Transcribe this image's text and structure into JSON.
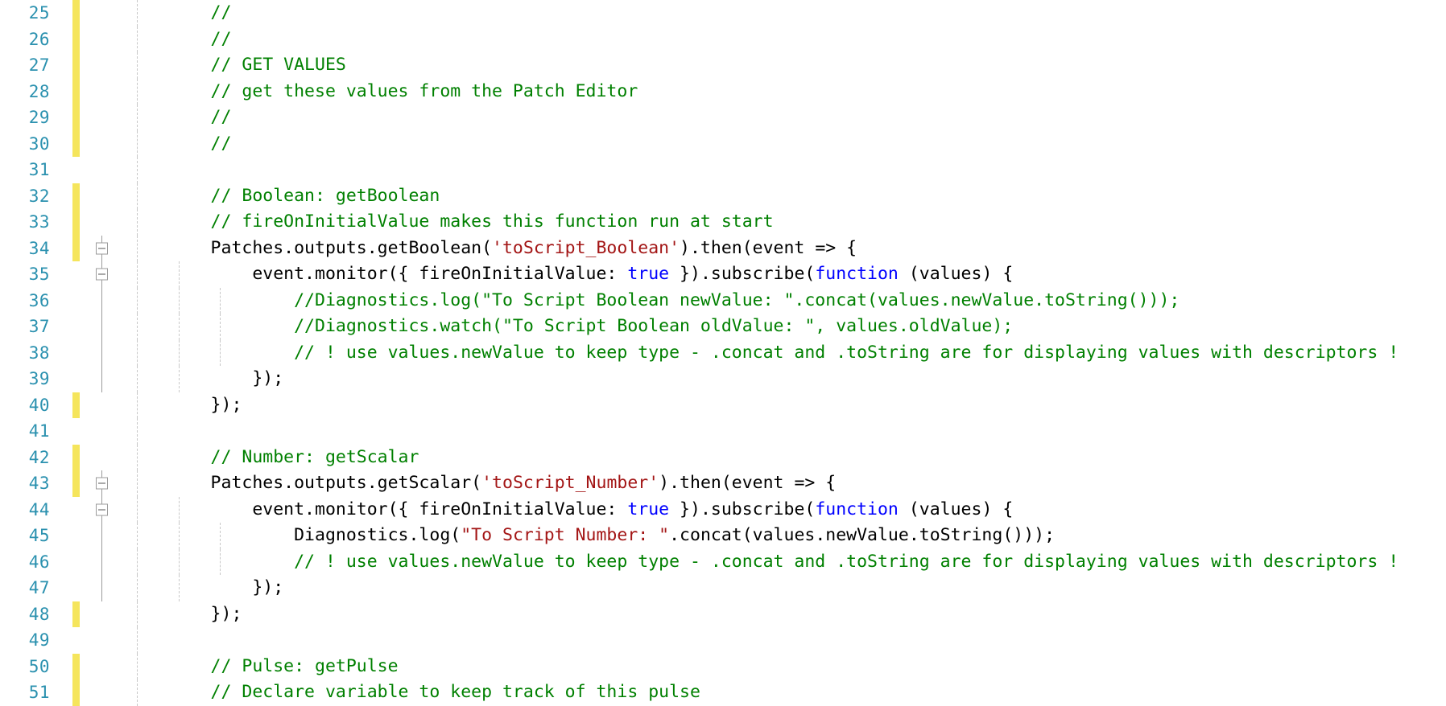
{
  "editor": {
    "name": "code-editor",
    "language": "javascript",
    "first_visible_line": 25,
    "last_visible_line": 51,
    "colors": {
      "background": "#ffffff",
      "line_number": "#2b91af",
      "comment": "#008000",
      "string": "#a31515",
      "keyword": "#0000ff",
      "plain_text": "#000000",
      "change_bar_modified": "#f5e55c",
      "indent_guide": "#c8c8c8",
      "fold_marker_border": "#9b9b9b"
    },
    "lines": [
      {
        "number": "25",
        "changed": true,
        "fold": false,
        "indent_guides": 1,
        "tokens": [
          {
            "text": "        // ",
            "cls": "t-comment"
          }
        ]
      },
      {
        "number": "26",
        "changed": true,
        "fold": false,
        "indent_guides": 1,
        "tokens": [
          {
            "text": "        //",
            "cls": "t-comment"
          }
        ]
      },
      {
        "number": "27",
        "changed": true,
        "fold": false,
        "indent_guides": 1,
        "tokens": [
          {
            "text": "        // GET VALUES",
            "cls": "t-comment"
          }
        ]
      },
      {
        "number": "28",
        "changed": true,
        "fold": false,
        "indent_guides": 1,
        "tokens": [
          {
            "text": "        // get these values from the Patch Editor",
            "cls": "t-comment"
          }
        ]
      },
      {
        "number": "29",
        "changed": true,
        "fold": false,
        "indent_guides": 1,
        "tokens": [
          {
            "text": "        //",
            "cls": "t-comment"
          }
        ]
      },
      {
        "number": "30",
        "changed": true,
        "fold": false,
        "indent_guides": 1,
        "tokens": [
          {
            "text": "        //",
            "cls": "t-comment"
          }
        ]
      },
      {
        "number": "31",
        "changed": false,
        "fold": false,
        "indent_guides": 1,
        "tokens": []
      },
      {
        "number": "32",
        "changed": true,
        "fold": false,
        "indent_guides": 1,
        "tokens": [
          {
            "text": "        // Boolean: getBoolean",
            "cls": "t-comment"
          }
        ]
      },
      {
        "number": "33",
        "changed": true,
        "fold": false,
        "indent_guides": 1,
        "tokens": [
          {
            "text": "        // fireOnInitialValue makes this function run at start",
            "cls": "t-comment"
          }
        ]
      },
      {
        "number": "34",
        "changed": true,
        "fold": true,
        "indent_guides": 1,
        "tokens": [
          {
            "text": "        Patches.outputs.getBoolean(",
            "cls": "t-plain"
          },
          {
            "text": "'toScript_Boolean'",
            "cls": "t-string"
          },
          {
            "text": ").then(event => {",
            "cls": "t-plain"
          }
        ]
      },
      {
        "number": "35",
        "changed": false,
        "fold": true,
        "indent_guides": 2,
        "tokens": [
          {
            "text": "            event.monitor({ fireOnInitialValue: ",
            "cls": "t-plain"
          },
          {
            "text": "true",
            "cls": "t-keyword"
          },
          {
            "text": " }).subscribe(",
            "cls": "t-plain"
          },
          {
            "text": "function",
            "cls": "t-keyword"
          },
          {
            "text": " (values) {",
            "cls": "t-plain"
          }
        ]
      },
      {
        "number": "36",
        "changed": false,
        "fold": false,
        "indent_guides": 3,
        "tokens": [
          {
            "text": "                //Diagnostics.log(\"To Script Boolean newValue: \".concat(values.newValue.toString()));",
            "cls": "t-comment"
          }
        ]
      },
      {
        "number": "37",
        "changed": false,
        "fold": false,
        "indent_guides": 3,
        "tokens": [
          {
            "text": "                //Diagnostics.watch(\"To Script Boolean oldValue: \", values.oldValue);",
            "cls": "t-comment"
          }
        ]
      },
      {
        "number": "38",
        "changed": false,
        "fold": false,
        "indent_guides": 3,
        "tokens": [
          {
            "text": "                // ! use values.newValue to keep type - .concat and .toString are for displaying values with descriptors !",
            "cls": "t-comment"
          }
        ]
      },
      {
        "number": "39",
        "changed": false,
        "fold": false,
        "indent_guides": 2,
        "tokens": [
          {
            "text": "            });",
            "cls": "t-plain"
          }
        ]
      },
      {
        "number": "40",
        "changed": true,
        "fold": false,
        "indent_guides": 1,
        "tokens": [
          {
            "text": "        });",
            "cls": "t-plain"
          }
        ]
      },
      {
        "number": "41",
        "changed": false,
        "fold": false,
        "indent_guides": 1,
        "tokens": []
      },
      {
        "number": "42",
        "changed": true,
        "fold": false,
        "indent_guides": 1,
        "tokens": [
          {
            "text": "        // Number: getScalar",
            "cls": "t-comment"
          }
        ]
      },
      {
        "number": "43",
        "changed": true,
        "fold": true,
        "indent_guides": 1,
        "tokens": [
          {
            "text": "        Patches.outputs.getScalar(",
            "cls": "t-plain"
          },
          {
            "text": "'toScript_Number'",
            "cls": "t-string"
          },
          {
            "text": ").then(event => {",
            "cls": "t-plain"
          }
        ]
      },
      {
        "number": "44",
        "changed": false,
        "fold": true,
        "indent_guides": 2,
        "tokens": [
          {
            "text": "            event.monitor({ fireOnInitialValue: ",
            "cls": "t-plain"
          },
          {
            "text": "true",
            "cls": "t-keyword"
          },
          {
            "text": " }).subscribe(",
            "cls": "t-plain"
          },
          {
            "text": "function",
            "cls": "t-keyword"
          },
          {
            "text": " (values) {",
            "cls": "t-plain"
          }
        ]
      },
      {
        "number": "45",
        "changed": false,
        "fold": false,
        "indent_guides": 3,
        "tokens": [
          {
            "text": "                Diagnostics.log(",
            "cls": "t-plain"
          },
          {
            "text": "\"To Script Number: \"",
            "cls": "t-string"
          },
          {
            "text": ".concat(values.newValue.toString()));",
            "cls": "t-plain"
          }
        ]
      },
      {
        "number": "46",
        "changed": false,
        "fold": false,
        "indent_guides": 3,
        "tokens": [
          {
            "text": "                // ! use values.newValue to keep type - .concat and .toString are for displaying values with descriptors !",
            "cls": "t-comment"
          }
        ]
      },
      {
        "number": "47",
        "changed": false,
        "fold": false,
        "indent_guides": 2,
        "tokens": [
          {
            "text": "            });",
            "cls": "t-plain"
          }
        ]
      },
      {
        "number": "48",
        "changed": true,
        "fold": false,
        "indent_guides": 1,
        "tokens": [
          {
            "text": "        });",
            "cls": "t-plain"
          }
        ]
      },
      {
        "number": "49",
        "changed": false,
        "fold": false,
        "indent_guides": 1,
        "tokens": []
      },
      {
        "number": "50",
        "changed": true,
        "fold": false,
        "indent_guides": 1,
        "tokens": [
          {
            "text": "        // Pulse: getPulse",
            "cls": "t-comment"
          }
        ]
      },
      {
        "number": "51",
        "changed": true,
        "fold": false,
        "indent_guides": 1,
        "tokens": [
          {
            "text": "        // Declare variable to keep track of this pulse",
            "cls": "t-comment"
          }
        ]
      }
    ]
  }
}
